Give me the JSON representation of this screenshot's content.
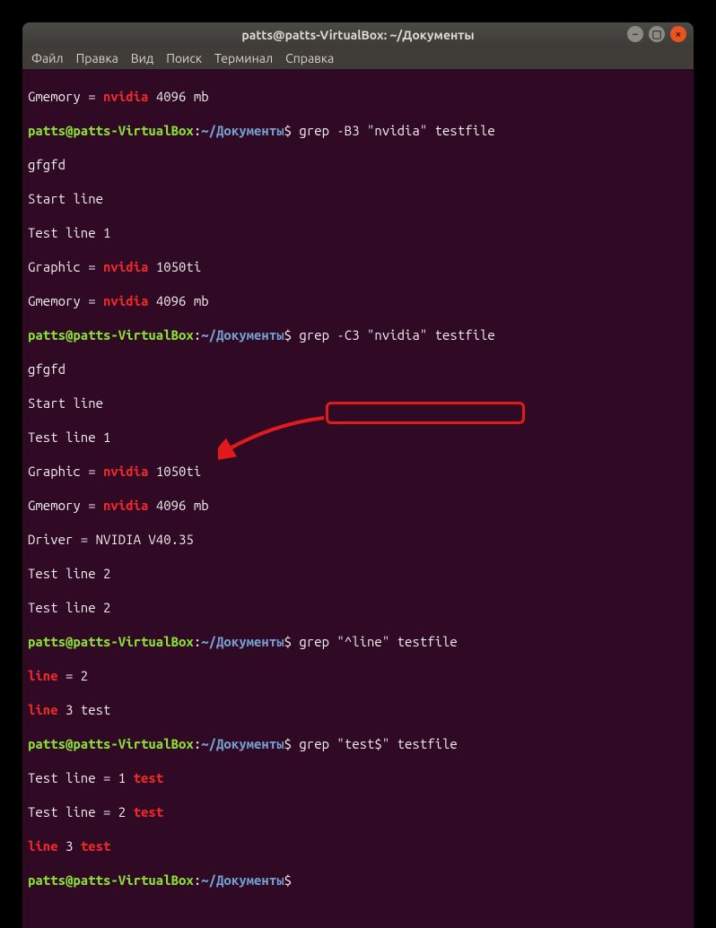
{
  "window": {
    "title": "patts@patts-VirtualBox: ~/Документы"
  },
  "menu": {
    "file": "Файл",
    "edit": "Правка",
    "view": "Вид",
    "search": "Поиск",
    "terminal": "Терминал",
    "help": "Справка"
  },
  "prompt": {
    "user_host": "patts@patts-VirtualBox",
    "colon": ":",
    "path": "~/Документы",
    "dollar": "$"
  },
  "lines": {
    "l01_a": "Gmemory = ",
    "l01_m": "nvidia",
    "l01_b": " 4096 mb",
    "cmd1": " grep -B3 \"nvidia\" testfile",
    "l03": "gfgfd",
    "l04": "Start line",
    "l05": "Test line 1",
    "l06_a": "Graphic = ",
    "l06_m": "nvidia",
    "l06_b": " 1050ti",
    "l07_a": "Gmemory = ",
    "l07_m": "nvidia",
    "l07_b": " 4096 mb",
    "cmd2": " grep -C3 \"nvidia\" testfile",
    "l09": "gfgfd",
    "l10": "Start line",
    "l11": "Test line 1",
    "l12_a": "Graphic = ",
    "l12_m": "nvidia",
    "l12_b": " 1050ti",
    "l13_a": "Gmemory = ",
    "l13_m": "nvidia",
    "l13_b": " 4096 mb",
    "l14": "Driver = NVIDIA V40.35",
    "l15": "Test line 2",
    "l16": "Test line 2",
    "cmd3": " grep \"^line\" testfile",
    "l18_m": "line",
    "l18_b": " = 2",
    "l19_m": "line",
    "l19_b": " 3 test",
    "cmd4": " grep \"test$\" testfile",
    "l21_a": "Test line = 1 ",
    "l21_m": "test",
    "l22_a": "Test line = 2 ",
    "l22_m": "test",
    "l23_m": "line",
    "l23_b": " 3 ",
    "l23_m2": "test",
    "cmd5": " "
  }
}
